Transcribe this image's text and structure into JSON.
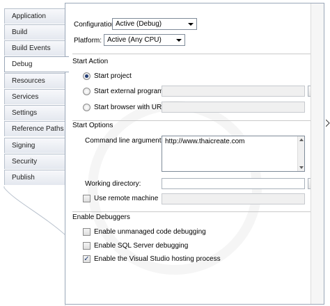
{
  "tabs": [
    {
      "label": "Application",
      "active": false
    },
    {
      "label": "Build",
      "active": false
    },
    {
      "label": "Build Events",
      "active": false
    },
    {
      "label": "Debug",
      "active": true
    },
    {
      "label": "Resources",
      "active": false
    },
    {
      "label": "Services",
      "active": false
    },
    {
      "label": "Settings",
      "active": false
    },
    {
      "label": "Reference Paths",
      "active": false
    },
    {
      "label": "Signing",
      "active": false
    },
    {
      "label": "Security",
      "active": false
    },
    {
      "label": "Publish",
      "active": false
    }
  ],
  "config": {
    "configuration_label": "Configuration:",
    "configuration_value": "Active (Debug)",
    "platform_label": "Platform:",
    "platform_value": "Active (Any CPU)"
  },
  "start_action": {
    "heading": "Start Action",
    "start_project": "Start project",
    "start_external": "Start external program:",
    "start_browser": "Start browser with URL:",
    "selected": "start_project",
    "browse_label": "..."
  },
  "start_options": {
    "heading": "Start Options",
    "cmd_label": "Command line arguments:",
    "cmd_value": "http://www.thaicreate.com",
    "working_dir_label": "Working directory:",
    "working_dir_value": "",
    "browse_label": "...",
    "remote_label": "Use remote machine",
    "remote_checked": false
  },
  "debuggers": {
    "heading": "Enable Debuggers",
    "unmanaged": {
      "label": "Enable unmanaged code debugging",
      "checked": false
    },
    "sql": {
      "label": "Enable SQL Server debugging",
      "checked": false
    },
    "hosting": {
      "label": "Enable the Visual Studio hosting process",
      "checked": true
    }
  },
  "icons": {
    "check": "✓"
  },
  "colors": {
    "border": "#9aa7b8",
    "tab_bg": "#e4e8ef",
    "selected_radio": "#1f3b73"
  }
}
